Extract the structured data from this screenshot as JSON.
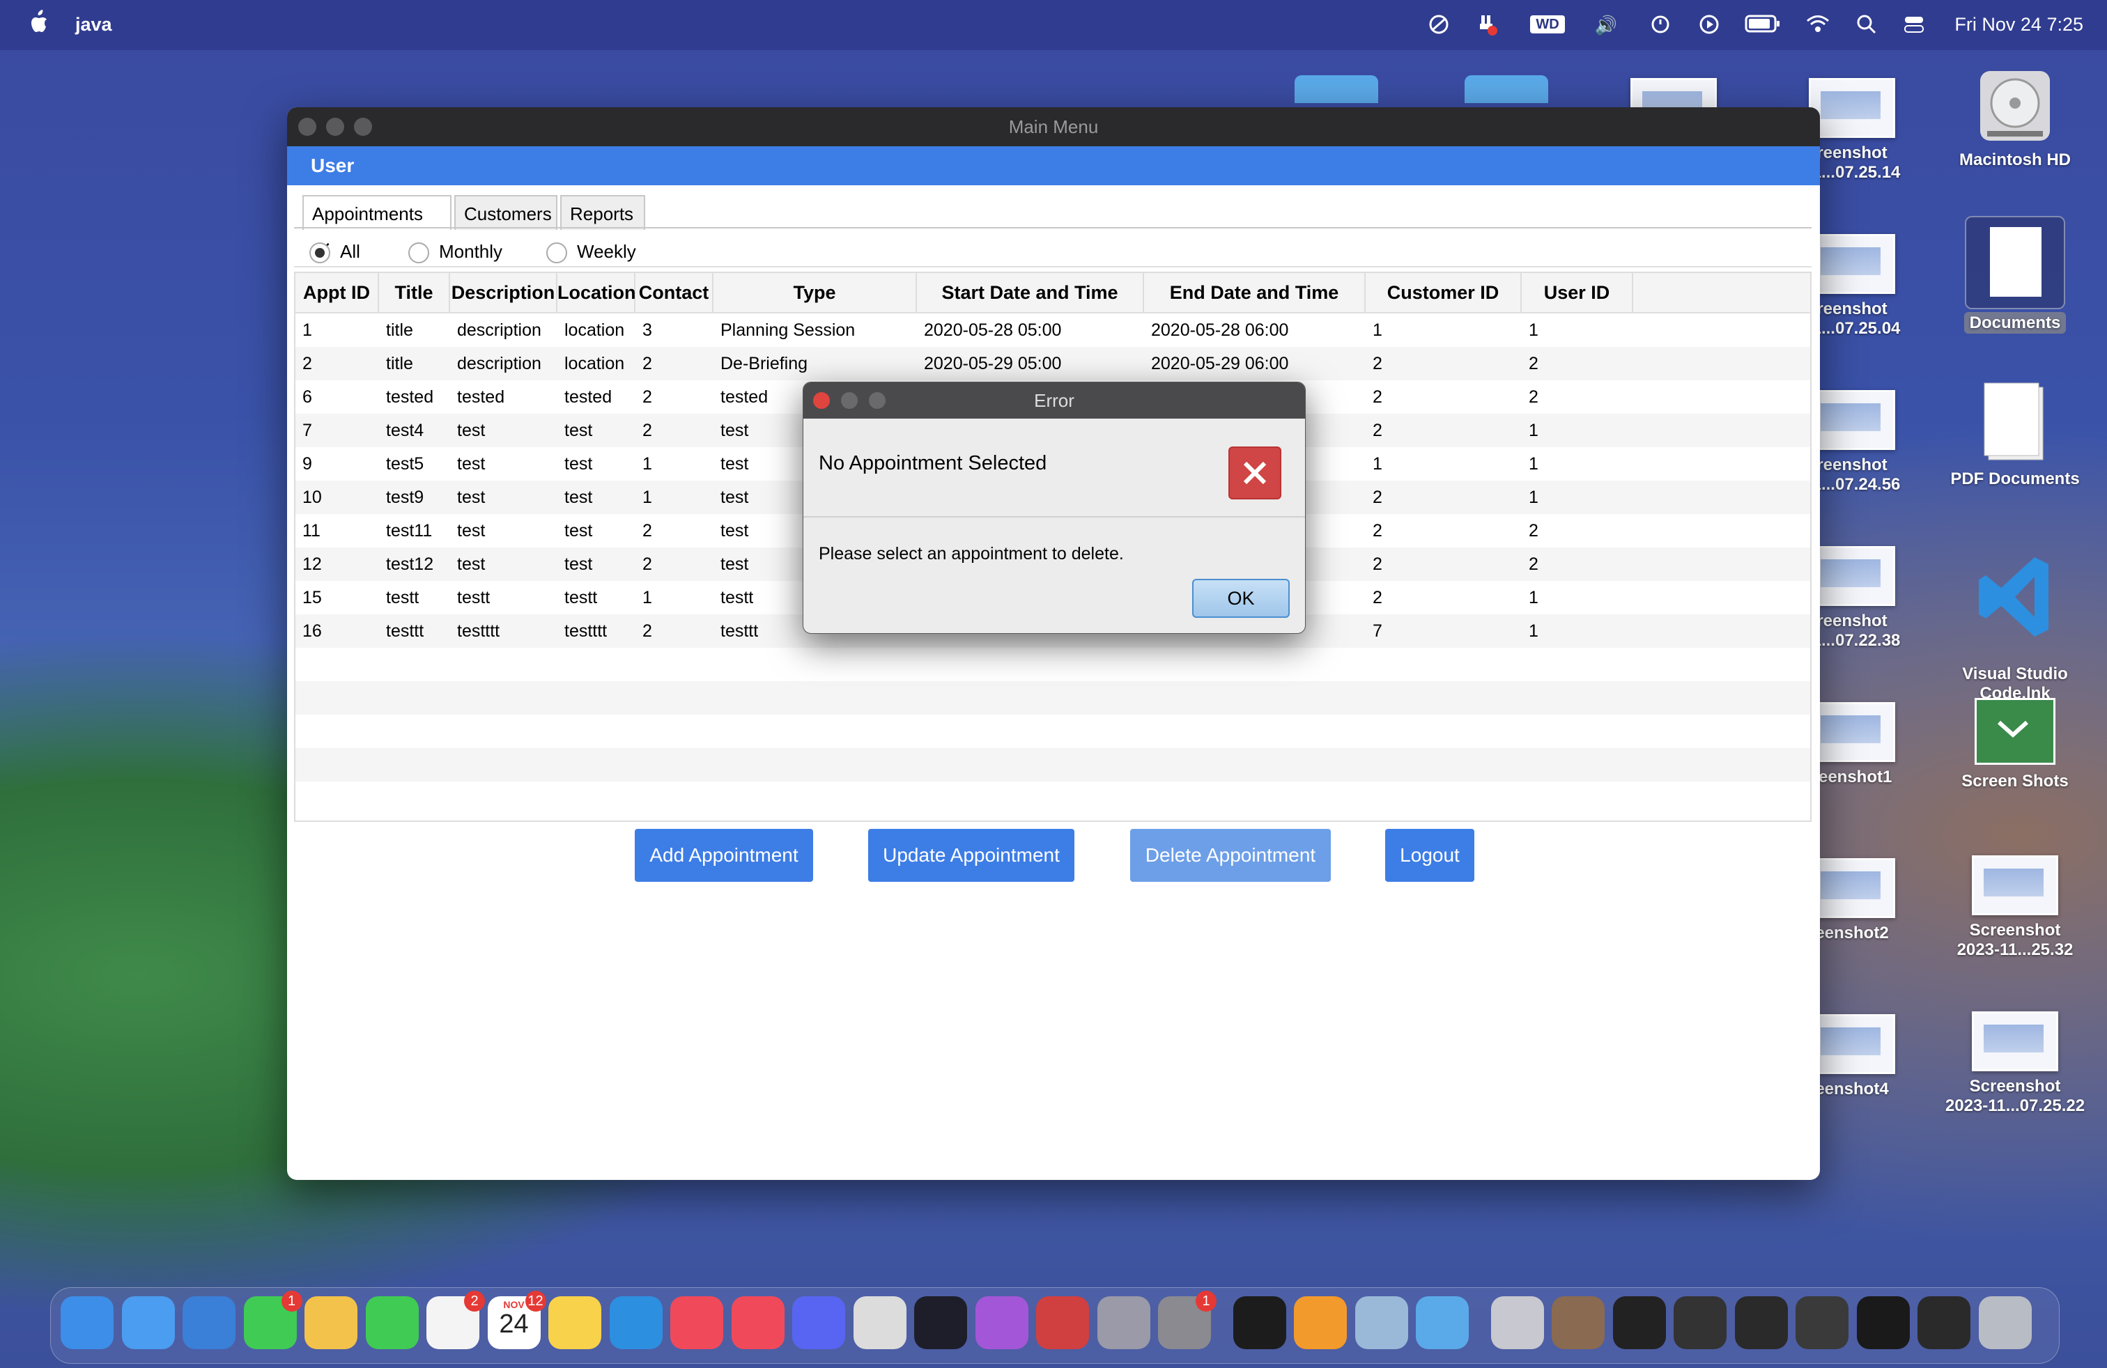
{
  "menubar": {
    "app_name": "java",
    "clock": "Fri Nov 24  7:25",
    "status_icons": [
      "focus-icon",
      "usb-alert-icon",
      "wd-drive-icon",
      "volume-icon",
      "time-machine-icon",
      "play-icon",
      "battery-icon",
      "wifi-icon",
      "spotlight-icon",
      "control-center-icon"
    ],
    "wd_label": "WD"
  },
  "desktop": {
    "icons": [
      {
        "name": "reenshot\n11...07.25.14"
      },
      {
        "name": "reenshot\n11...07.25.04"
      },
      {
        "name": "reenshot\n11...07.24.56"
      },
      {
        "name": "reenshot\n11...07.22.38"
      },
      {
        "name": "reenshot1"
      },
      {
        "name": "eenshot2"
      },
      {
        "name": "eenshot4"
      },
      {
        "name": "Macintosh HD"
      },
      {
        "name": "Documents"
      },
      {
        "name": "PDF Documents"
      },
      {
        "name": "Visual Studio\nCode.lnk"
      },
      {
        "name": "Screen Shots"
      },
      {
        "name": "Screenshot\n2023-11...25.32"
      },
      {
        "name": "Screenshot\n2023-11...07.25.22"
      }
    ]
  },
  "window": {
    "title": "Main Menu",
    "user_label": "User",
    "tabs": [
      {
        "label": "Appointments"
      },
      {
        "label": "Customers"
      },
      {
        "label": "Reports"
      }
    ],
    "tab_close": "✕",
    "filters": [
      {
        "label": "All",
        "selected": true
      },
      {
        "label": "Monthly",
        "selected": false
      },
      {
        "label": "Weekly",
        "selected": false
      }
    ],
    "table": {
      "columns": [
        "Appt ID",
        "Title",
        "Description",
        "Location",
        "Contact",
        "Type",
        "Start Date and Time",
        "End Date and Time",
        "Customer ID",
        "User ID"
      ],
      "rows": [
        [
          "1",
          "title",
          "description",
          "location",
          "3",
          "Planning Session",
          "2020-05-28 05:00",
          "2020-05-28 06:00",
          "1",
          "1"
        ],
        [
          "2",
          "title",
          "description",
          "location",
          "2",
          "De-Briefing",
          "2020-05-29 05:00",
          "2020-05-29 06:00",
          "2",
          "2"
        ],
        [
          "6",
          "tested",
          "tested",
          "tested",
          "2",
          "tested",
          "",
          "",
          "2",
          "2"
        ],
        [
          "7",
          "test4",
          "test",
          "test",
          "2",
          "test",
          "",
          "",
          "2",
          "1"
        ],
        [
          "9",
          "test5",
          "test",
          "test",
          "1",
          "test",
          "",
          "",
          "1",
          "1"
        ],
        [
          "10",
          "test9",
          "test",
          "test",
          "1",
          "test",
          "",
          "",
          "2",
          "1"
        ],
        [
          "11",
          "test11",
          "test",
          "test",
          "2",
          "test",
          "",
          "",
          "2",
          "2"
        ],
        [
          "12",
          "test12",
          "test",
          "test",
          "2",
          "test",
          "",
          "",
          "2",
          "2"
        ],
        [
          "15",
          "testt",
          "testt",
          "testt",
          "1",
          "testt",
          "",
          "",
          "2",
          "1"
        ],
        [
          "16",
          "testtt",
          "testttt",
          "testttt",
          "2",
          "testtt",
          "",
          "",
          "7",
          "1"
        ]
      ]
    },
    "buttons": {
      "add": "Add Appointment",
      "update": "Update Appointment",
      "delete": "Delete Appointment",
      "logout": "Logout"
    }
  },
  "dialog": {
    "title": "Error",
    "header": "No Appointment Selected",
    "message": "Please select an appointment to delete.",
    "ok": "OK"
  },
  "dock": {
    "badges": {
      "messages": "1",
      "reminders": "2",
      "calendar": "12",
      "settings": "1"
    },
    "calendar_month": "NOV",
    "calendar_day": "24"
  },
  "colors": {
    "accent": "#3d7de6",
    "error_red": "#d04545"
  }
}
